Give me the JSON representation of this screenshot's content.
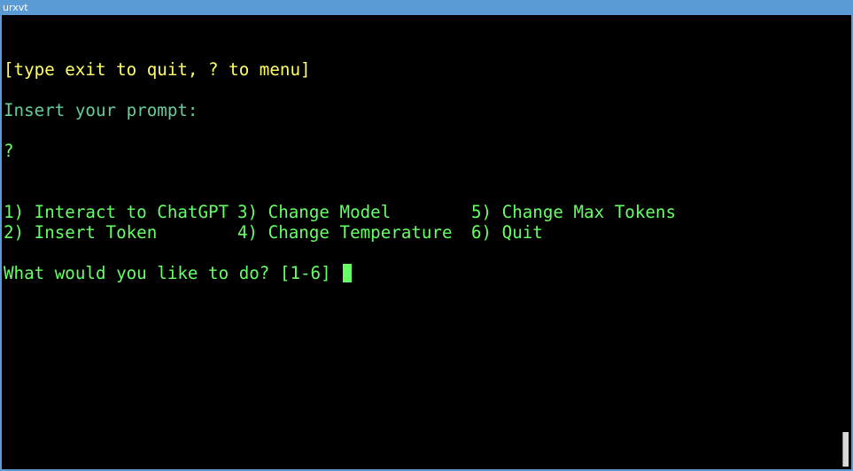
{
  "window": {
    "title": "urxvt"
  },
  "terminal": {
    "hint": "[type exit to quit, ? to menu]",
    "prompt_label": "Insert your prompt:",
    "input": "?",
    "menu": {
      "row1": {
        "opt1": "1) Interact to ChatGPT",
        "opt3": "3) Change Model",
        "opt5": "5) Change Max Tokens"
      },
      "row2": {
        "opt2": "2) Insert Token",
        "opt4": "4) Change Temperature",
        "opt6": "6) Quit"
      }
    },
    "question": "What would you like to do? [1-6] "
  },
  "colors": {
    "titlebar": "#5b9bd5",
    "background": "#000000",
    "green_text": "#66ff66",
    "yellow_text": "#ffff66",
    "teal_text": "#66cc99"
  }
}
